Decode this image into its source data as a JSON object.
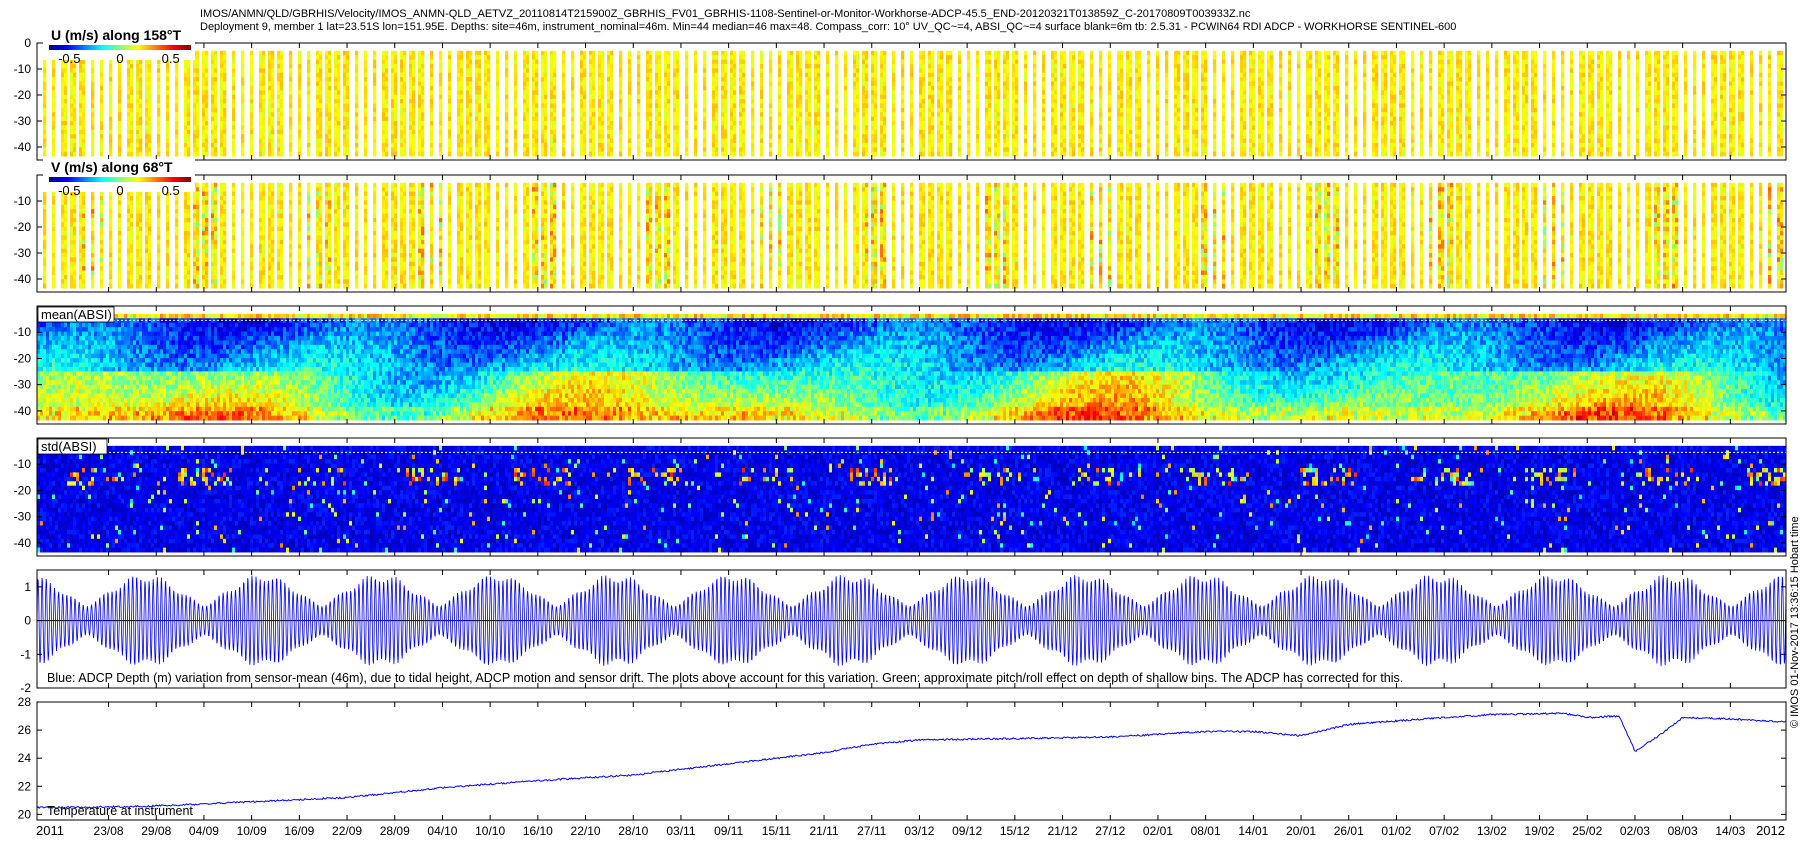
{
  "header": {
    "line1": "IMOS/ANMN/QLD/GBRHIS/Velocity/IMOS_ANMN-QLD_AETVZ_20110814T215900Z_GBRHIS_FV01_GBRHIS-1108-Sentinel-or-Monitor-Workhorse-ADCP-45.5_END-20120321T013859Z_C-20170809T003933Z.nc",
    "line2": "Deployment 9, member 1 lat=23.51S lon=151.95E. Depths: site=46m, instrument_nominal=46m. Min=44 median=46 max=48. Compass_corr: 10° UV_QC~=4, ABSI_QC~=4 surface blank=6m tb: 2.5.31 - PCWIN64 RDI ADCP - WORKHORSE SENTINEL-600"
  },
  "credit": "© IMOS 01-Nov-2017 13:36:15 Hobart time",
  "colors": {
    "line_blue": "#0000ff",
    "cmap": [
      "#00008f",
      "#0000ff",
      "#0080ff",
      "#00ffff",
      "#80ff80",
      "#ffff00",
      "#ff8000",
      "#ff0000",
      "#800000"
    ]
  },
  "chart_data": [
    {
      "type": "heatmap",
      "title": "U (m/s) along 158°T",
      "colorbar": {
        "ticks": [
          "-0.5",
          "0",
          "0.5"
        ],
        "range": [
          -0.7,
          0.7
        ]
      },
      "ylim": [
        -45,
        0
      ],
      "yticks": [
        0,
        -10,
        -20,
        -30,
        -40
      ],
      "ytick_labels": [
        "0",
        "-10",
        "-20",
        "-30",
        "-40"
      ],
      "dominant_value": 0.1
    },
    {
      "type": "heatmap",
      "title": "V (m/s) along 68°T",
      "colorbar": {
        "ticks": [
          "-0.5",
          "0",
          "0.5"
        ],
        "range": [
          -0.7,
          0.7
        ]
      },
      "ylim": [
        -45,
        0
      ],
      "yticks": [
        -10,
        -20,
        -30,
        -40
      ],
      "ytick_labels": [
        "-10",
        "-20",
        "-30",
        "-40"
      ],
      "dominant_value": 0.15
    },
    {
      "type": "heatmap",
      "title": "mean(ABSI)",
      "ylim": [
        -45,
        0
      ],
      "yticks": [
        -10,
        -20,
        -30,
        -40
      ],
      "ytick_labels": [
        "-10",
        "-20",
        "-30",
        "-40"
      ]
    },
    {
      "type": "heatmap",
      "title": "std(ABSI)",
      "ylim": [
        -45,
        0
      ],
      "yticks": [
        -10,
        -20,
        -30,
        -40
      ],
      "ytick_labels": [
        "-10",
        "-20",
        "-30",
        "-40"
      ]
    },
    {
      "type": "line",
      "annotation": "Blue: ADCP Depth (m) variation from sensor-mean (46m), due to tidal height, ADCP motion and sensor drift. The plots above account for this variation. Green: approximate pitch/roll effect on depth of shallow bins. The ADCP has corrected for this.",
      "ylim": [
        -2,
        1.5
      ],
      "yticks": [
        1,
        0,
        -1,
        -2
      ],
      "ytick_labels": [
        "1",
        "0",
        "-1",
        "-2"
      ],
      "spring_tide_amplitude": 1.4,
      "neap_tide_amplitude": 0.5
    },
    {
      "type": "line",
      "annotation": "Temperature at instrument",
      "ylim": [
        19.6,
        28
      ],
      "yticks": [
        20,
        22,
        24,
        26,
        28
      ],
      "ytick_labels": [
        "20",
        "22",
        "24",
        "26",
        "28"
      ],
      "x": [
        "2011-08-14",
        "2011-08-20",
        "2011-08-29",
        "2011-09-10",
        "2011-09-22",
        "2011-10-04",
        "2011-10-16",
        "2011-10-28",
        "2011-11-09",
        "2011-11-21",
        "2011-11-27",
        "2011-12-03",
        "2011-12-15",
        "2011-12-27",
        "2012-01-08",
        "2012-01-14",
        "2012-01-20",
        "2012-01-26",
        "2012-02-07",
        "2012-02-13",
        "2012-02-22",
        "2012-02-25",
        "2012-02-29",
        "2012-03-02",
        "2012-03-05",
        "2012-03-08",
        "2012-03-14",
        "2012-03-20"
      ],
      "y": [
        20.5,
        20.5,
        20.6,
        20.9,
        21.2,
        21.9,
        22.4,
        22.8,
        23.6,
        24.4,
        25.0,
        25.3,
        25.4,
        25.5,
        25.9,
        25.9,
        25.6,
        26.4,
        26.9,
        27.1,
        27.2,
        26.9,
        27.0,
        24.5,
        25.6,
        26.9,
        26.8,
        26.6
      ]
    }
  ],
  "x_axis": {
    "year_start": "2011",
    "year_end": "2012",
    "ticks": [
      "23/08",
      "29/08",
      "04/09",
      "10/09",
      "16/09",
      "22/09",
      "28/09",
      "04/10",
      "10/10",
      "16/10",
      "22/10",
      "28/10",
      "03/11",
      "09/11",
      "15/11",
      "21/11",
      "27/11",
      "03/12",
      "09/12",
      "15/12",
      "21/12",
      "27/12",
      "02/01",
      "08/01",
      "14/01",
      "20/01",
      "26/01",
      "01/02",
      "07/02",
      "13/02",
      "19/02",
      "25/02",
      "02/03",
      "08/03",
      "14/03"
    ]
  }
}
